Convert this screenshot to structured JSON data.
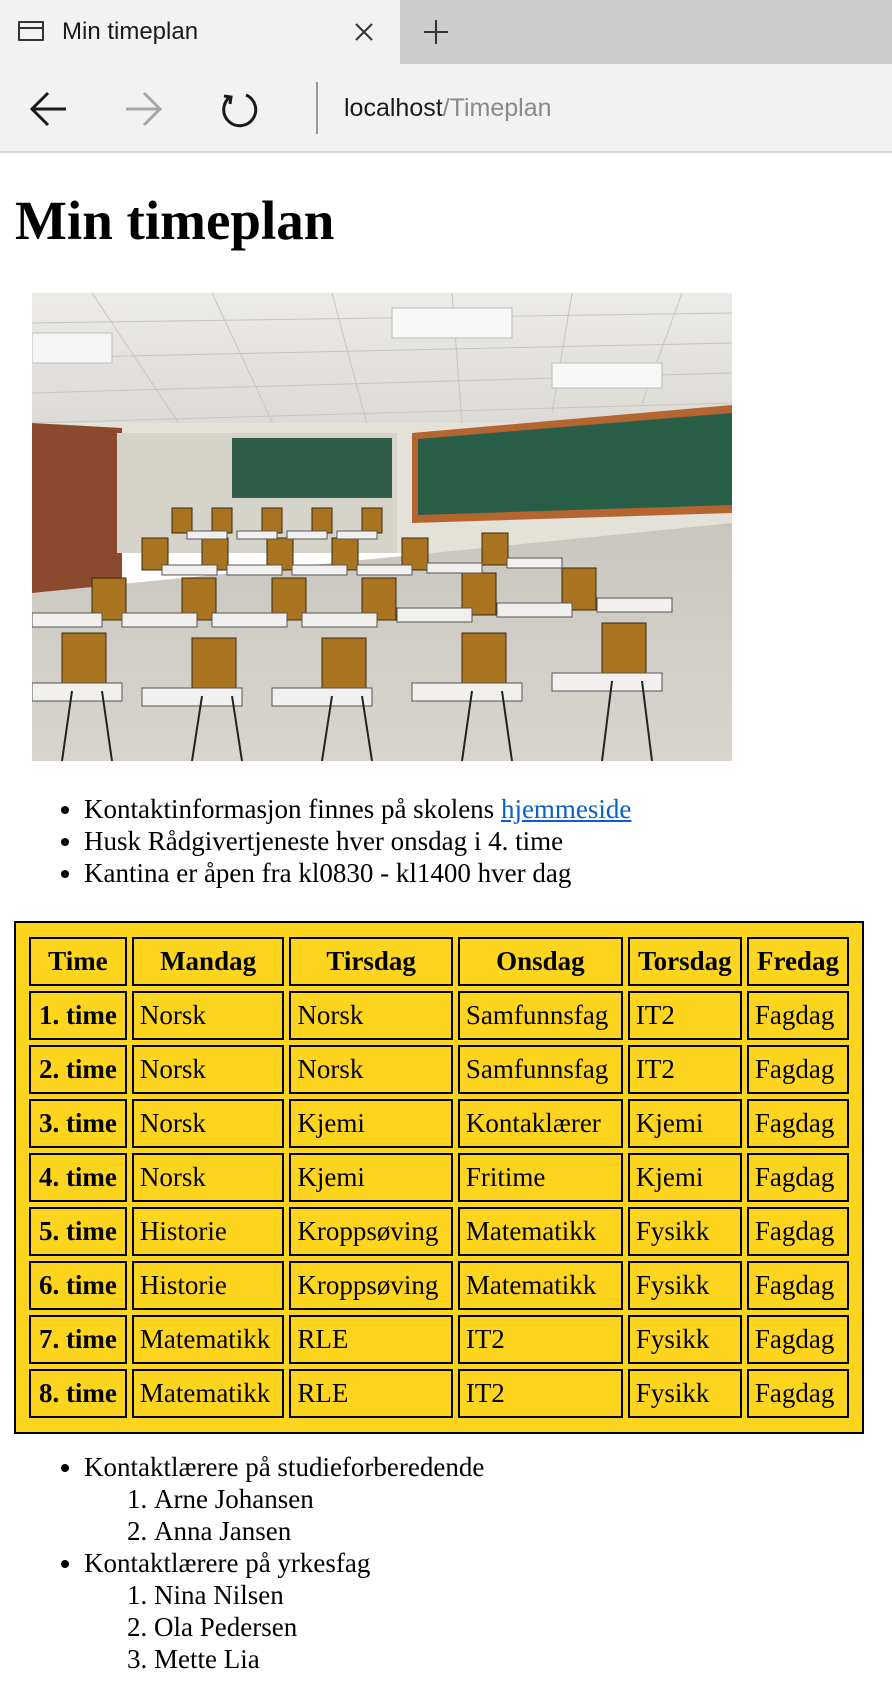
{
  "browser": {
    "tab_title": "Min timeplan",
    "address_host": "localhost",
    "address_path": "/Timeplan"
  },
  "page": {
    "heading": "Min timeplan",
    "info": {
      "item1_text": "Kontaktinformasjon finnes på skolens ",
      "item1_link": "hjemmeside",
      "item2": "Husk Rådgivertjeneste hver onsdag i 4. time",
      "item3": "Kantina er åpen fra kl0830 - kl1400 hver dag"
    },
    "schedule": {
      "headers": [
        "Time",
        "Mandag",
        "Tirsdag",
        "Onsdag",
        "Torsdag",
        "Fredag"
      ],
      "rows": [
        [
          "1. time",
          "Norsk",
          "Norsk",
          "Samfunnsfag",
          "IT2",
          "Fagdag"
        ],
        [
          "2. time",
          "Norsk",
          "Norsk",
          "Samfunnsfag",
          "IT2",
          "Fagdag"
        ],
        [
          "3. time",
          "Norsk",
          "Kjemi",
          "Kontaklærer",
          "Kjemi",
          "Fagdag"
        ],
        [
          "4. time",
          "Norsk",
          "Kjemi",
          "Fritime",
          "Kjemi",
          "Fagdag"
        ],
        [
          "5. time",
          "Historie",
          "Kroppsøving",
          "Matematikk",
          "Fysikk",
          "Fagdag"
        ],
        [
          "6. time",
          "Historie",
          "Kroppsøving",
          "Matematikk",
          "Fysikk",
          "Fagdag"
        ],
        [
          "7. time",
          "Matematikk",
          "RLE",
          "IT2",
          "Fysikk",
          "Fagdag"
        ],
        [
          "8. time",
          "Matematikk",
          "RLE",
          "IT2",
          "Fysikk",
          "Fagdag"
        ]
      ]
    },
    "teachers": [
      {
        "group": "Kontaktlærere på studieforberedende",
        "names": [
          "Arne Johansen",
          "Anna Jansen"
        ]
      },
      {
        "group": "Kontaktlærere på yrkesfag",
        "names": [
          "Nina Nilsen",
          "Ola Pedersen",
          "Mette Lia"
        ]
      }
    ]
  },
  "colors": {
    "table_background": "#fdd51e",
    "link": "#0b5fc9"
  },
  "icons": {
    "tab": "tab-page-icon",
    "close": "close-icon",
    "new_tab": "plus-icon",
    "back": "arrow-left-icon",
    "forward": "arrow-right-icon",
    "refresh": "refresh-icon",
    "hero_image": "classroom-photo"
  }
}
